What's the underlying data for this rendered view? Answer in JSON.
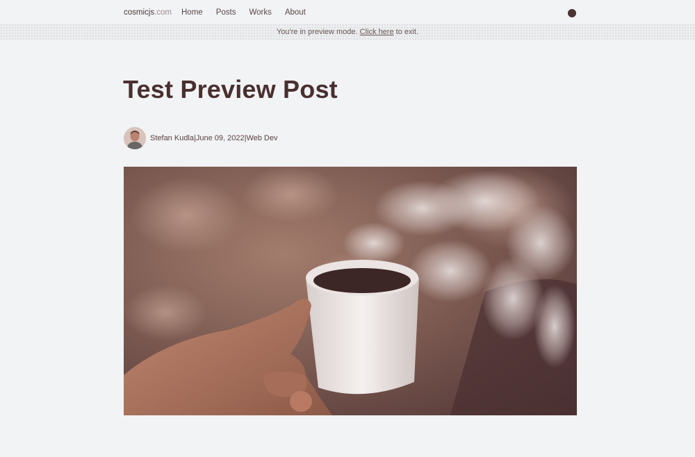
{
  "nav": {
    "brand_main": "cosmicjs",
    "brand_tld": ".com",
    "links": [
      "Home",
      "Posts",
      "Works",
      "About"
    ]
  },
  "preview": {
    "prefix": "You're in preview mode. ",
    "link": "Click here",
    "suffix": " to exit."
  },
  "post": {
    "title": "Test Preview Post",
    "author": "Stefan Kudla",
    "date": "June 09, 2022",
    "category": "Web Dev",
    "separator": " | "
  },
  "colors": {
    "background": "#f1f3f5",
    "text_primary": "#4a2f2f",
    "theme_toggle": "#4a3333"
  },
  "icons": {
    "theme_toggle": "dot-icon"
  }
}
